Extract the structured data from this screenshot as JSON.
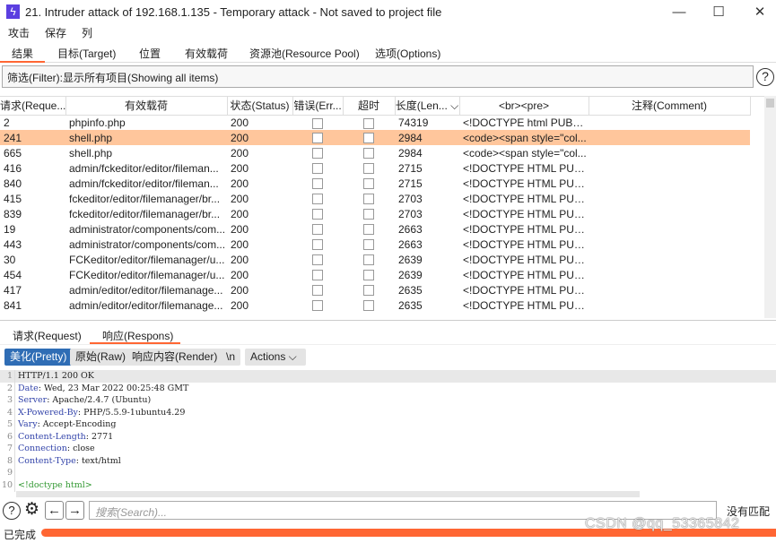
{
  "window": {
    "title": "21. Intruder attack of 192.168.1.135 - Temporary attack - Not saved to project file",
    "minimize": "—",
    "maximize": "☐",
    "close": "✕"
  },
  "menu": [
    "攻击",
    "保存",
    "列"
  ],
  "tabs": [
    "结果",
    "目标(Target)",
    "位置",
    "有效载荷",
    "资源池(Resource Pool)",
    "选项(Options)"
  ],
  "filter": "筛选(Filter):显示所有项目(Showing all items)",
  "table": {
    "columns": [
      "请求(Reque...",
      "有效载荷",
      "状态(Status)",
      "错误(Err...",
      "超时",
      "长度(Len... ⌵",
      "<br><pre>",
      "注释(Comment)"
    ],
    "rows": [
      [
        "2",
        "phpinfo.php",
        "200",
        "74319",
        "<!DOCTYPE html PUBLIC ..."
      ],
      [
        "241",
        "shell.php",
        "200",
        "2984",
        "<code><span style=\"col..."
      ],
      [
        "665",
        "shell.php",
        "200",
        "2984",
        "<code><span style=\"col..."
      ],
      [
        "416",
        "admin/fckeditor/editor/fileman...",
        "200",
        "2715",
        "<!DOCTYPE HTML PUBLI..."
      ],
      [
        "840",
        "admin/fckeditor/editor/fileman...",
        "200",
        "2715",
        "<!DOCTYPE HTML PUBLI..."
      ],
      [
        "415",
        "fckeditor/editor/filemanager/br...",
        "200",
        "2703",
        "<!DOCTYPE HTML PUBLI..."
      ],
      [
        "839",
        "fckeditor/editor/filemanager/br...",
        "200",
        "2703",
        "<!DOCTYPE HTML PUBLI..."
      ],
      [
        "19",
        "administrator/components/com...",
        "200",
        "2663",
        "<!DOCTYPE HTML PUBLI..."
      ],
      [
        "443",
        "administrator/components/com...",
        "200",
        "2663",
        "<!DOCTYPE HTML PUBLI..."
      ],
      [
        "30",
        "FCKeditor/editor/filemanager/u...",
        "200",
        "2639",
        "<!DOCTYPE HTML PUBLI..."
      ],
      [
        "454",
        "FCKeditor/editor/filemanager/u...",
        "200",
        "2639",
        "<!DOCTYPE HTML PUBLI..."
      ],
      [
        "417",
        "admin/editor/editor/filemanage...",
        "200",
        "2635",
        "<!DOCTYPE HTML PUBLI..."
      ],
      [
        "841",
        "admin/editor/editor/filemanage...",
        "200",
        "2635",
        "<!DOCTYPE HTML PUBLI..."
      ]
    ],
    "selected_row": 1
  },
  "lower_tabs": [
    "请求(Request)",
    "响应(Respons)"
  ],
  "view_buttons": {
    "pretty": "美化(Pretty)",
    "raw": "原始(Raw)",
    "render": "响应内容(Render)",
    "newline": "\\n",
    "actions": "Actions ⌵"
  },
  "response": [
    {
      "n": "1",
      "key": "",
      "val": "HTTP/1.1 200 OK"
    },
    {
      "n": "2",
      "key": "Date",
      "val": ": Wed, 23 Mar 2022 00:25:48 GMT"
    },
    {
      "n": "3",
      "key": "Server",
      "val": ": Apache/2.4.7 (Ubuntu)"
    },
    {
      "n": "4",
      "key": "X-Powered-By",
      "val": ": PHP/5.5.9-1ubuntu4.29"
    },
    {
      "n": "5",
      "key": "Vary",
      "val": ": Accept-Encoding"
    },
    {
      "n": "6",
      "key": "Content-Length",
      "val": ": 2771"
    },
    {
      "n": "7",
      "key": "Connection",
      "val": ": close"
    },
    {
      "n": "8",
      "key": "Content-Type",
      "val": ": text/html"
    },
    {
      "n": "9",
      "key": "",
      "val": ""
    },
    {
      "n": "10",
      "key": "",
      "val": "<!doctype html>"
    }
  ],
  "search": {
    "placeholder": "搜索(Search)...",
    "result": "没有匹配"
  },
  "status": {
    "text": "已完成",
    "progress": 100
  },
  "watermark": "CSDN @qq_53365842",
  "colors": {
    "accent": "#ff6633",
    "selected_row": "#ffc69c",
    "pretty_button": "#2f6db5"
  }
}
